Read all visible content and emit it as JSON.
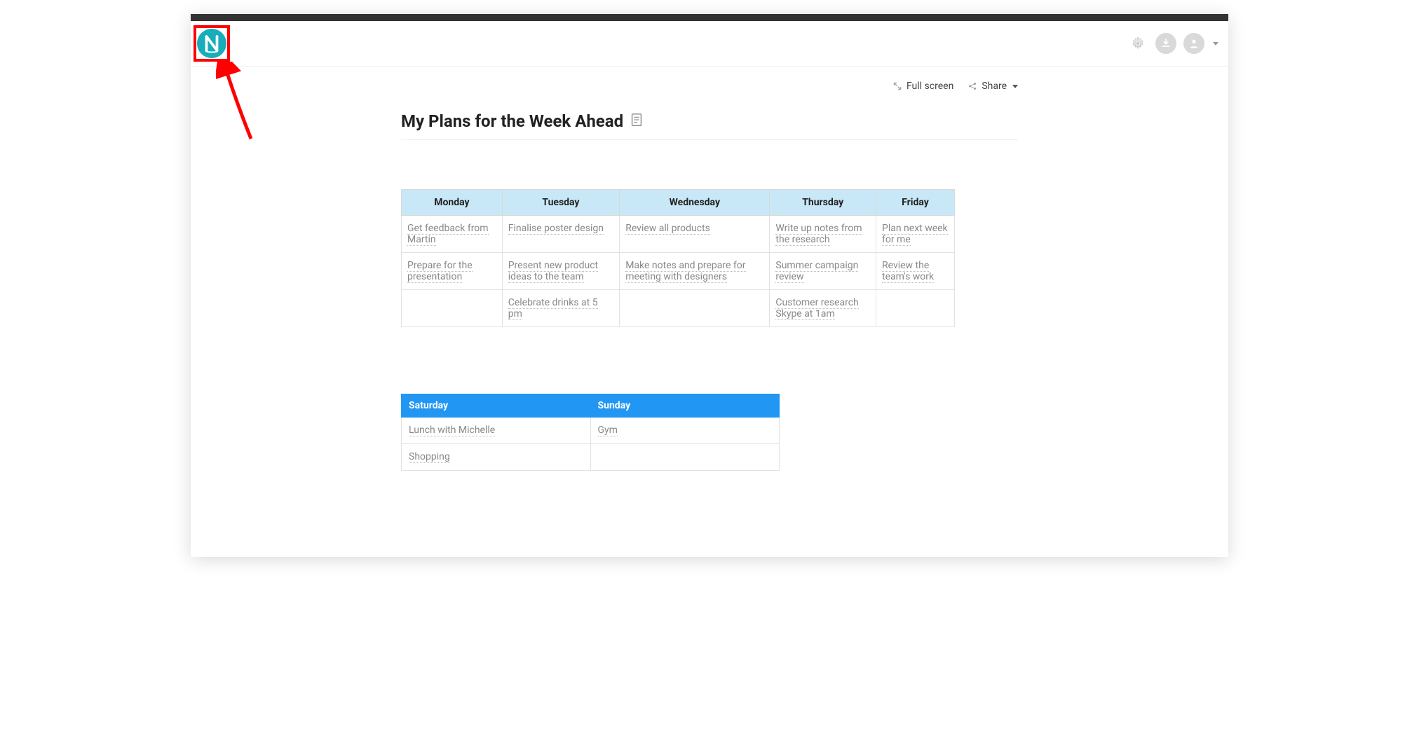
{
  "toolbar": {
    "fullscreen": "Full screen",
    "share": "Share"
  },
  "doc": {
    "title": "My Plans for the Week Ahead"
  },
  "week": {
    "headers": [
      "Monday",
      "Tuesday",
      "Wednesday",
      "Thursday",
      "Friday"
    ],
    "rows": [
      [
        "Get feedback from Martin",
        "Finalise poster design",
        "Review all products",
        "Write up notes from the research",
        "Plan next week for me"
      ],
      [
        "Prepare for the presentation",
        "Present new product ideas to the team",
        "Make notes and prepare for meeting with designers",
        "Summer campaign review",
        "Review the team's work"
      ],
      [
        "",
        "Celebrate drinks at 5 pm",
        "",
        "Customer research Skype at 1am",
        ""
      ]
    ]
  },
  "weekend": {
    "headers": [
      "Saturday",
      "Sunday"
    ],
    "rows": [
      [
        "Lunch with Michelle",
        "Gym"
      ],
      [
        "Shopping",
        ""
      ]
    ]
  }
}
